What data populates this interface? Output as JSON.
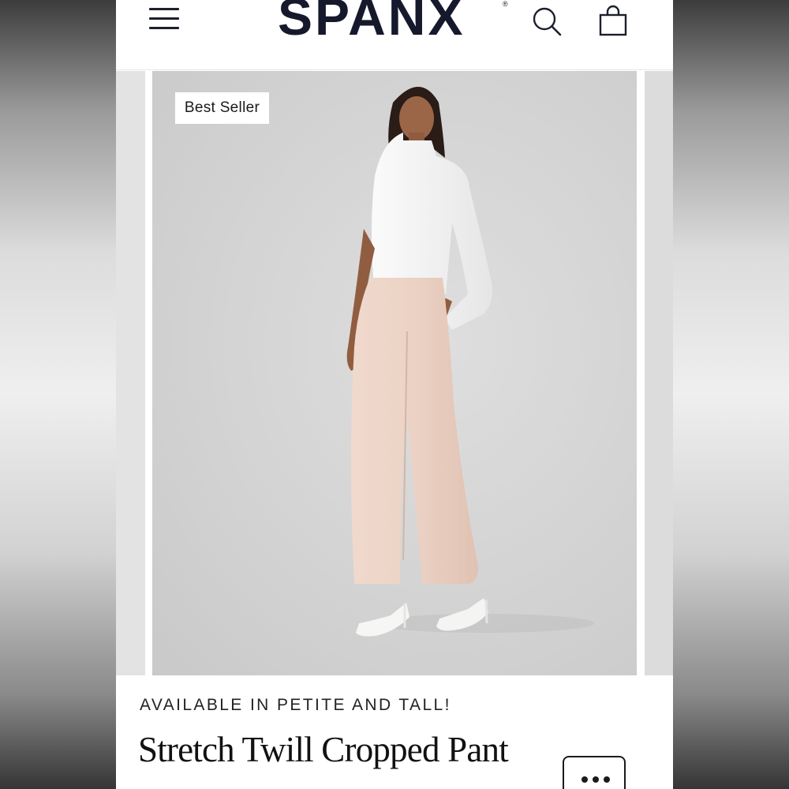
{
  "header": {
    "brand": "SPANX",
    "brand_mark": "®",
    "menu_icon": "hamburger-menu-icon",
    "search_icon": "search-icon",
    "bag_icon": "shopping-bag-icon"
  },
  "product": {
    "badge": "Best Seller",
    "availability": "AVAILABLE IN PETITE AND TALL!",
    "name": "Stretch Twill Cropped Pant",
    "image_description_icon": "product-photo"
  },
  "more_button": {
    "icon": "ellipsis-icon"
  },
  "colors": {
    "brand_navy": "#15192b",
    "photo_bg": "#d3d3d3",
    "pant_color": "#e9cfc2",
    "top_color": "#f5f5f5"
  }
}
